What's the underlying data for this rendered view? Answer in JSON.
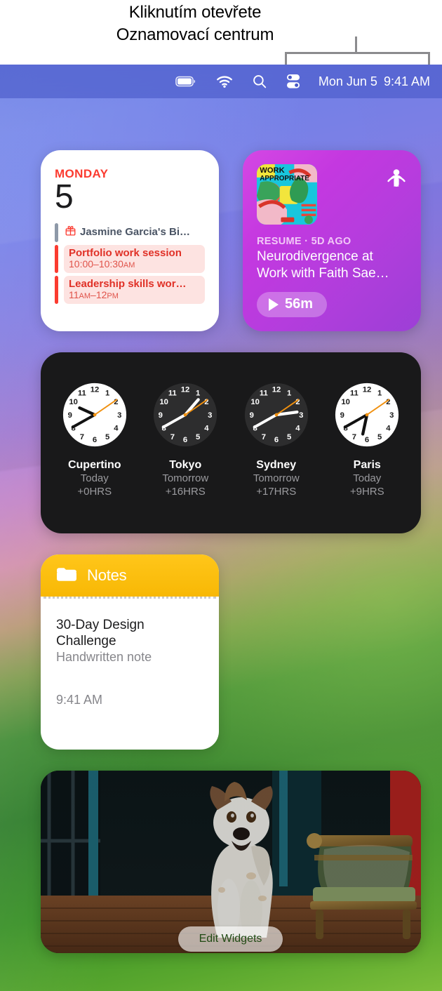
{
  "callout": {
    "text": "Kliknutím otevřete\nOznamovací centrum",
    "bracket_color": "#8b8b8e"
  },
  "menubar": {
    "background": "#4858c8",
    "icons": [
      {
        "name": "battery-icon",
        "label": "Battery"
      },
      {
        "name": "wifi-icon",
        "label": "Wi-Fi"
      },
      {
        "name": "search-icon",
        "label": "Spotlight Search"
      },
      {
        "name": "control-center-icon",
        "label": "Control Center"
      }
    ],
    "date": "Mon Jun 5",
    "time": "9:41 AM"
  },
  "widgets": {
    "calendar": {
      "day_name": "MONDAY",
      "day_number": "5",
      "accent": "#fb3b30",
      "events": [
        {
          "kind": "birthday",
          "title": "Jasmine Garcia's Bi…",
          "time": "",
          "bar": "grey",
          "icon": "gift-icon"
        },
        {
          "kind": "event",
          "title": "Portfolio work session",
          "time": "10:00–10:30",
          "ampm": "AM",
          "bar": "red"
        },
        {
          "kind": "event",
          "title": "Leadership skills wor…",
          "time": "11",
          "ampm": "AM",
          "time2": "–12",
          "ampm2": "PM",
          "bar": "red"
        }
      ]
    },
    "podcast": {
      "app_icon": "podcast-icon",
      "artwork_title": "WORK APPROPRIATE",
      "meta": "RESUME · 5D AGO",
      "title": "Neurodivergence at Work with Faith Sae…",
      "duration": "56m",
      "play_icon": "play-icon",
      "gradient_from": "#d447e4",
      "gradient_to": "#9c3fd6"
    },
    "clocks": {
      "background": "#19191a",
      "second_hand_color": "#f0900f",
      "items": [
        {
          "city": "Cupertino",
          "day": "Today",
          "offset": "+0HRS",
          "face": "light",
          "hour": 9,
          "minute": 41,
          "second": 10
        },
        {
          "city": "Tokyo",
          "day": "Tomorrow",
          "offset": "+16HRS",
          "face": "dark",
          "hour": 1,
          "minute": 41,
          "second": 10
        },
        {
          "city": "Sydney",
          "day": "Tomorrow",
          "offset": "+17HRS",
          "face": "dark",
          "hour": 2,
          "minute": 41,
          "second": 10
        },
        {
          "city": "Paris",
          "day": "Today",
          "offset": "+9HRS",
          "face": "light",
          "hour": 6,
          "minute": 41,
          "second": 10
        }
      ]
    },
    "notes": {
      "header_title": "Notes",
      "folder_icon": "folder-icon",
      "header_color": "#ffc61a",
      "note_title": "30-Day Design Challenge",
      "note_subtitle": "Handwritten note",
      "note_time": "9:41 AM"
    },
    "photo": {
      "alt": "Dog sitting on wooden floor next to a green upholstered armchair"
    }
  },
  "edit_widgets_button": {
    "label": "Edit Widgets"
  }
}
